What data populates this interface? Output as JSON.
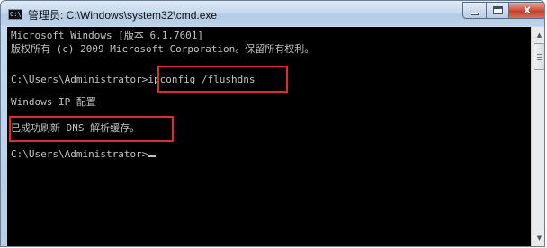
{
  "window": {
    "title": "管理员: C:\\Windows\\system32\\cmd.exe",
    "icon": "cmd-icon",
    "controls": {
      "minimize": "minimize-icon",
      "maximize": "maximize-icon",
      "close": "close-icon",
      "close_glyph": "x"
    }
  },
  "console": {
    "header_line1": "Microsoft Windows [版本 6.1.7601]",
    "header_line2": "版权所有 (c) 2009 Microsoft Corporation。保留所有权利。",
    "prompt1": "C:\\Users\\Administrator>",
    "command": "ipconfig /flushdns",
    "output_line1": "Windows IP 配置",
    "output_line2": "已成功刷新 DNS 解析缓存。",
    "prompt2": "C:\\Users\\Administrator>"
  },
  "colors": {
    "highlight": "#e12a2a",
    "console_bg": "#000000",
    "console_text": "#c0c0c0"
  }
}
